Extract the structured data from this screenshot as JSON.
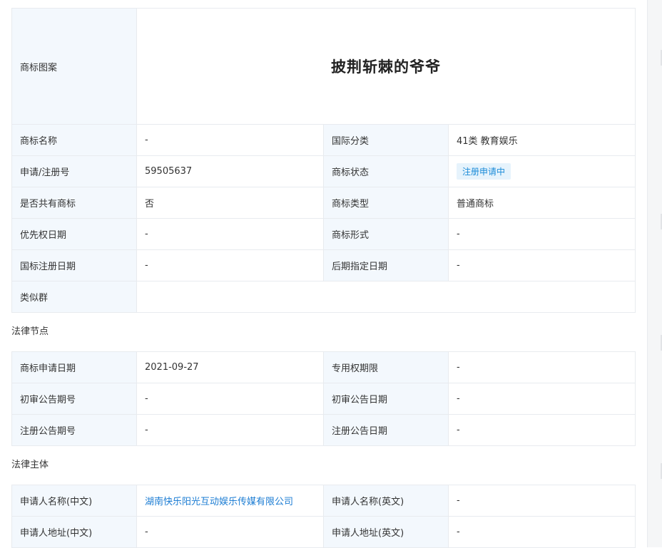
{
  "trademark": {
    "image_label": "商标图案",
    "image_text": "披荆斩棘的爷爷",
    "rows": [
      {
        "l1": "商标名称",
        "v1": "-",
        "l2": "国际分类",
        "v2": "41类 教育娱乐"
      },
      {
        "l1": "申请/注册号",
        "v1": "59505637",
        "l2": "商标状态",
        "v2": "注册申请中"
      },
      {
        "l1": "是否共有商标",
        "v1": "否",
        "l2": "商标类型",
        "v2": "普通商标"
      },
      {
        "l1": "优先权日期",
        "v1": "-",
        "l2": "商标形式",
        "v2": "-"
      },
      {
        "l1": "国标注册日期",
        "v1": "-",
        "l2": "后期指定日期",
        "v2": "-"
      }
    ],
    "similar_label": "类似群",
    "similar_value": ""
  },
  "legal_nodes": {
    "title": "法律节点",
    "rows": [
      {
        "l1": "商标申请日期",
        "v1": "2021-09-27",
        "l2": "专用权期限",
        "v2": "-"
      },
      {
        "l1": "初审公告期号",
        "v1": "-",
        "l2": "初审公告日期",
        "v2": "-"
      },
      {
        "l1": "注册公告期号",
        "v1": "-",
        "l2": "注册公告日期",
        "v2": "-"
      }
    ]
  },
  "legal_subject": {
    "title": "法律主体",
    "rows": [
      {
        "l1": "申请人名称(中文)",
        "v1": "湖南快乐阳光互动娱乐传媒有限公司",
        "l2": "申请人名称(英文)",
        "v2": "-"
      },
      {
        "l1": "申请人地址(中文)",
        "v1": "-",
        "l2": "申请人地址(英文)",
        "v2": "-"
      }
    ]
  },
  "colors": {
    "label_bg": "#f3f8fd",
    "border": "#e8ebef",
    "link": "#1b7cd3",
    "badge_bg": "#e6f3fc",
    "badge_text": "#1b8bd8"
  }
}
